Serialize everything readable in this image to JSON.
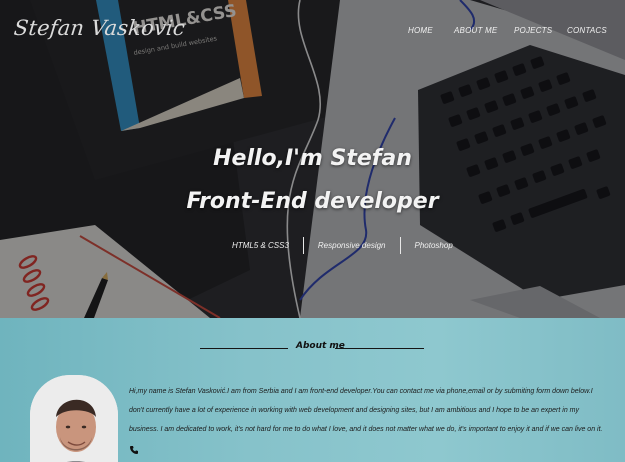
{
  "brand": {
    "name": "Stefan Vaskovic"
  },
  "nav": {
    "items": [
      {
        "label": "HOME"
      },
      {
        "label": "ABOUT ME"
      },
      {
        "label": "POJECTS"
      },
      {
        "label": "CONTACS"
      }
    ]
  },
  "hero": {
    "greeting": "Hello,I'm Stefan",
    "role": "Front-End developer",
    "skills": [
      {
        "label": "HTML5 & CSS3"
      },
      {
        "label": "Responsive design"
      },
      {
        "label": "Photoshop"
      }
    ],
    "book_title": "HTML&CSS",
    "book_subtitle": "design and build websites"
  },
  "about": {
    "heading": "About me",
    "bio": "Hi,my name is Stefan Vasković.I am from Serbia and I am front-end developer.You can contact me via phone,email or by submiting form down below.I don't currently have a lot of experience in working with web development and designing sites, but I am ambitious and I hope to be an expert in my business. I am dedicated to work, it's not hard for me to do what I love, and it does not matter what we do, it's important to enjoy it and if we can live on it."
  },
  "colors": {
    "about_bg": "#86c2ca",
    "hero_overlay": "#1b1c1f",
    "accent_blue": "#3a8fc4",
    "accent_orange": "#e7883a"
  },
  "icons": {
    "phone": "phone-icon"
  }
}
